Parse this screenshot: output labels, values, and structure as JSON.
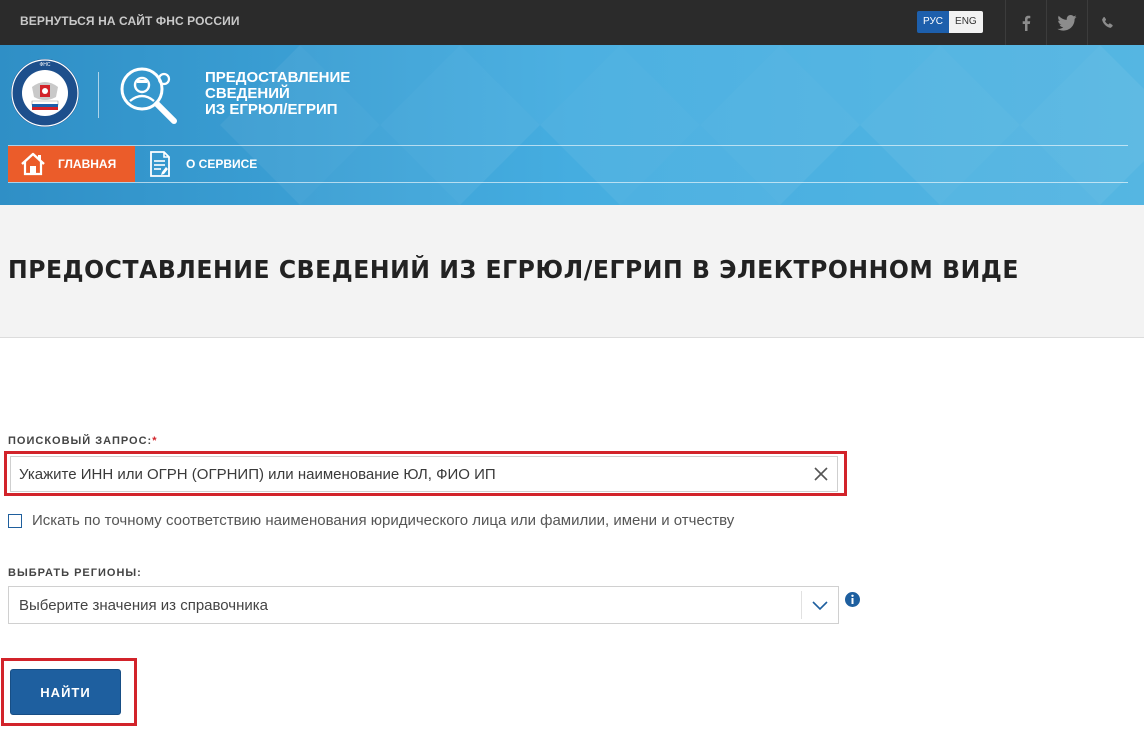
{
  "topbar": {
    "back_link": "ВЕРНУТЬСЯ НА САЙТ ФНС РОССИИ",
    "lang_ru": "РУС",
    "lang_en": "ENG",
    "social_icons": [
      "facebook-icon",
      "twitter-icon",
      "phone-icon"
    ]
  },
  "header": {
    "emblem_text": "ФЕДЕРАЛЬНАЯ НАЛОГОВАЯ СЛУЖБА",
    "service_title_line1": "ПРЕДОСТАВЛЕНИЕ",
    "service_title_line2": "СВЕДЕНИЙ",
    "service_title_line3": "ИЗ ЕГРЮЛ/ЕГРИП",
    "nav": [
      {
        "label": "ГЛАВНАЯ",
        "icon": "home-icon",
        "active": true
      },
      {
        "label": "О СЕРВИСЕ",
        "icon": "document-icon",
        "active": false
      }
    ]
  },
  "page": {
    "title": "ПРЕДОСТАВЛЕНИЕ СВЕДЕНИЙ ИЗ ЕГРЮЛ/ЕГРИП В ЭЛЕКТРОННОМ ВИДЕ"
  },
  "form": {
    "query_label": "ПОИСКОВЫЙ ЗАПРОС:",
    "query_required_mark": "*",
    "query_placeholder": "Укажите ИНН или ОГРН (ОГРНИП) или наименование ЮЛ, ФИО ИП",
    "query_value": "",
    "exact_match_label": "Искать по точному соответствию наименования юридического лица или фамилии, имени и отчеству",
    "exact_match_checked": false,
    "regions_label": "ВЫБРАТЬ РЕГИОНЫ:",
    "regions_selected": "Выберите значения из справочника",
    "submit_label": "НАЙТИ"
  },
  "colors": {
    "topbar": "#2b2b2b",
    "header_blue": "#3da3d4",
    "nav_active": "#eb5c2a",
    "button": "#1e5f9f",
    "highlight": "#d2232a"
  }
}
